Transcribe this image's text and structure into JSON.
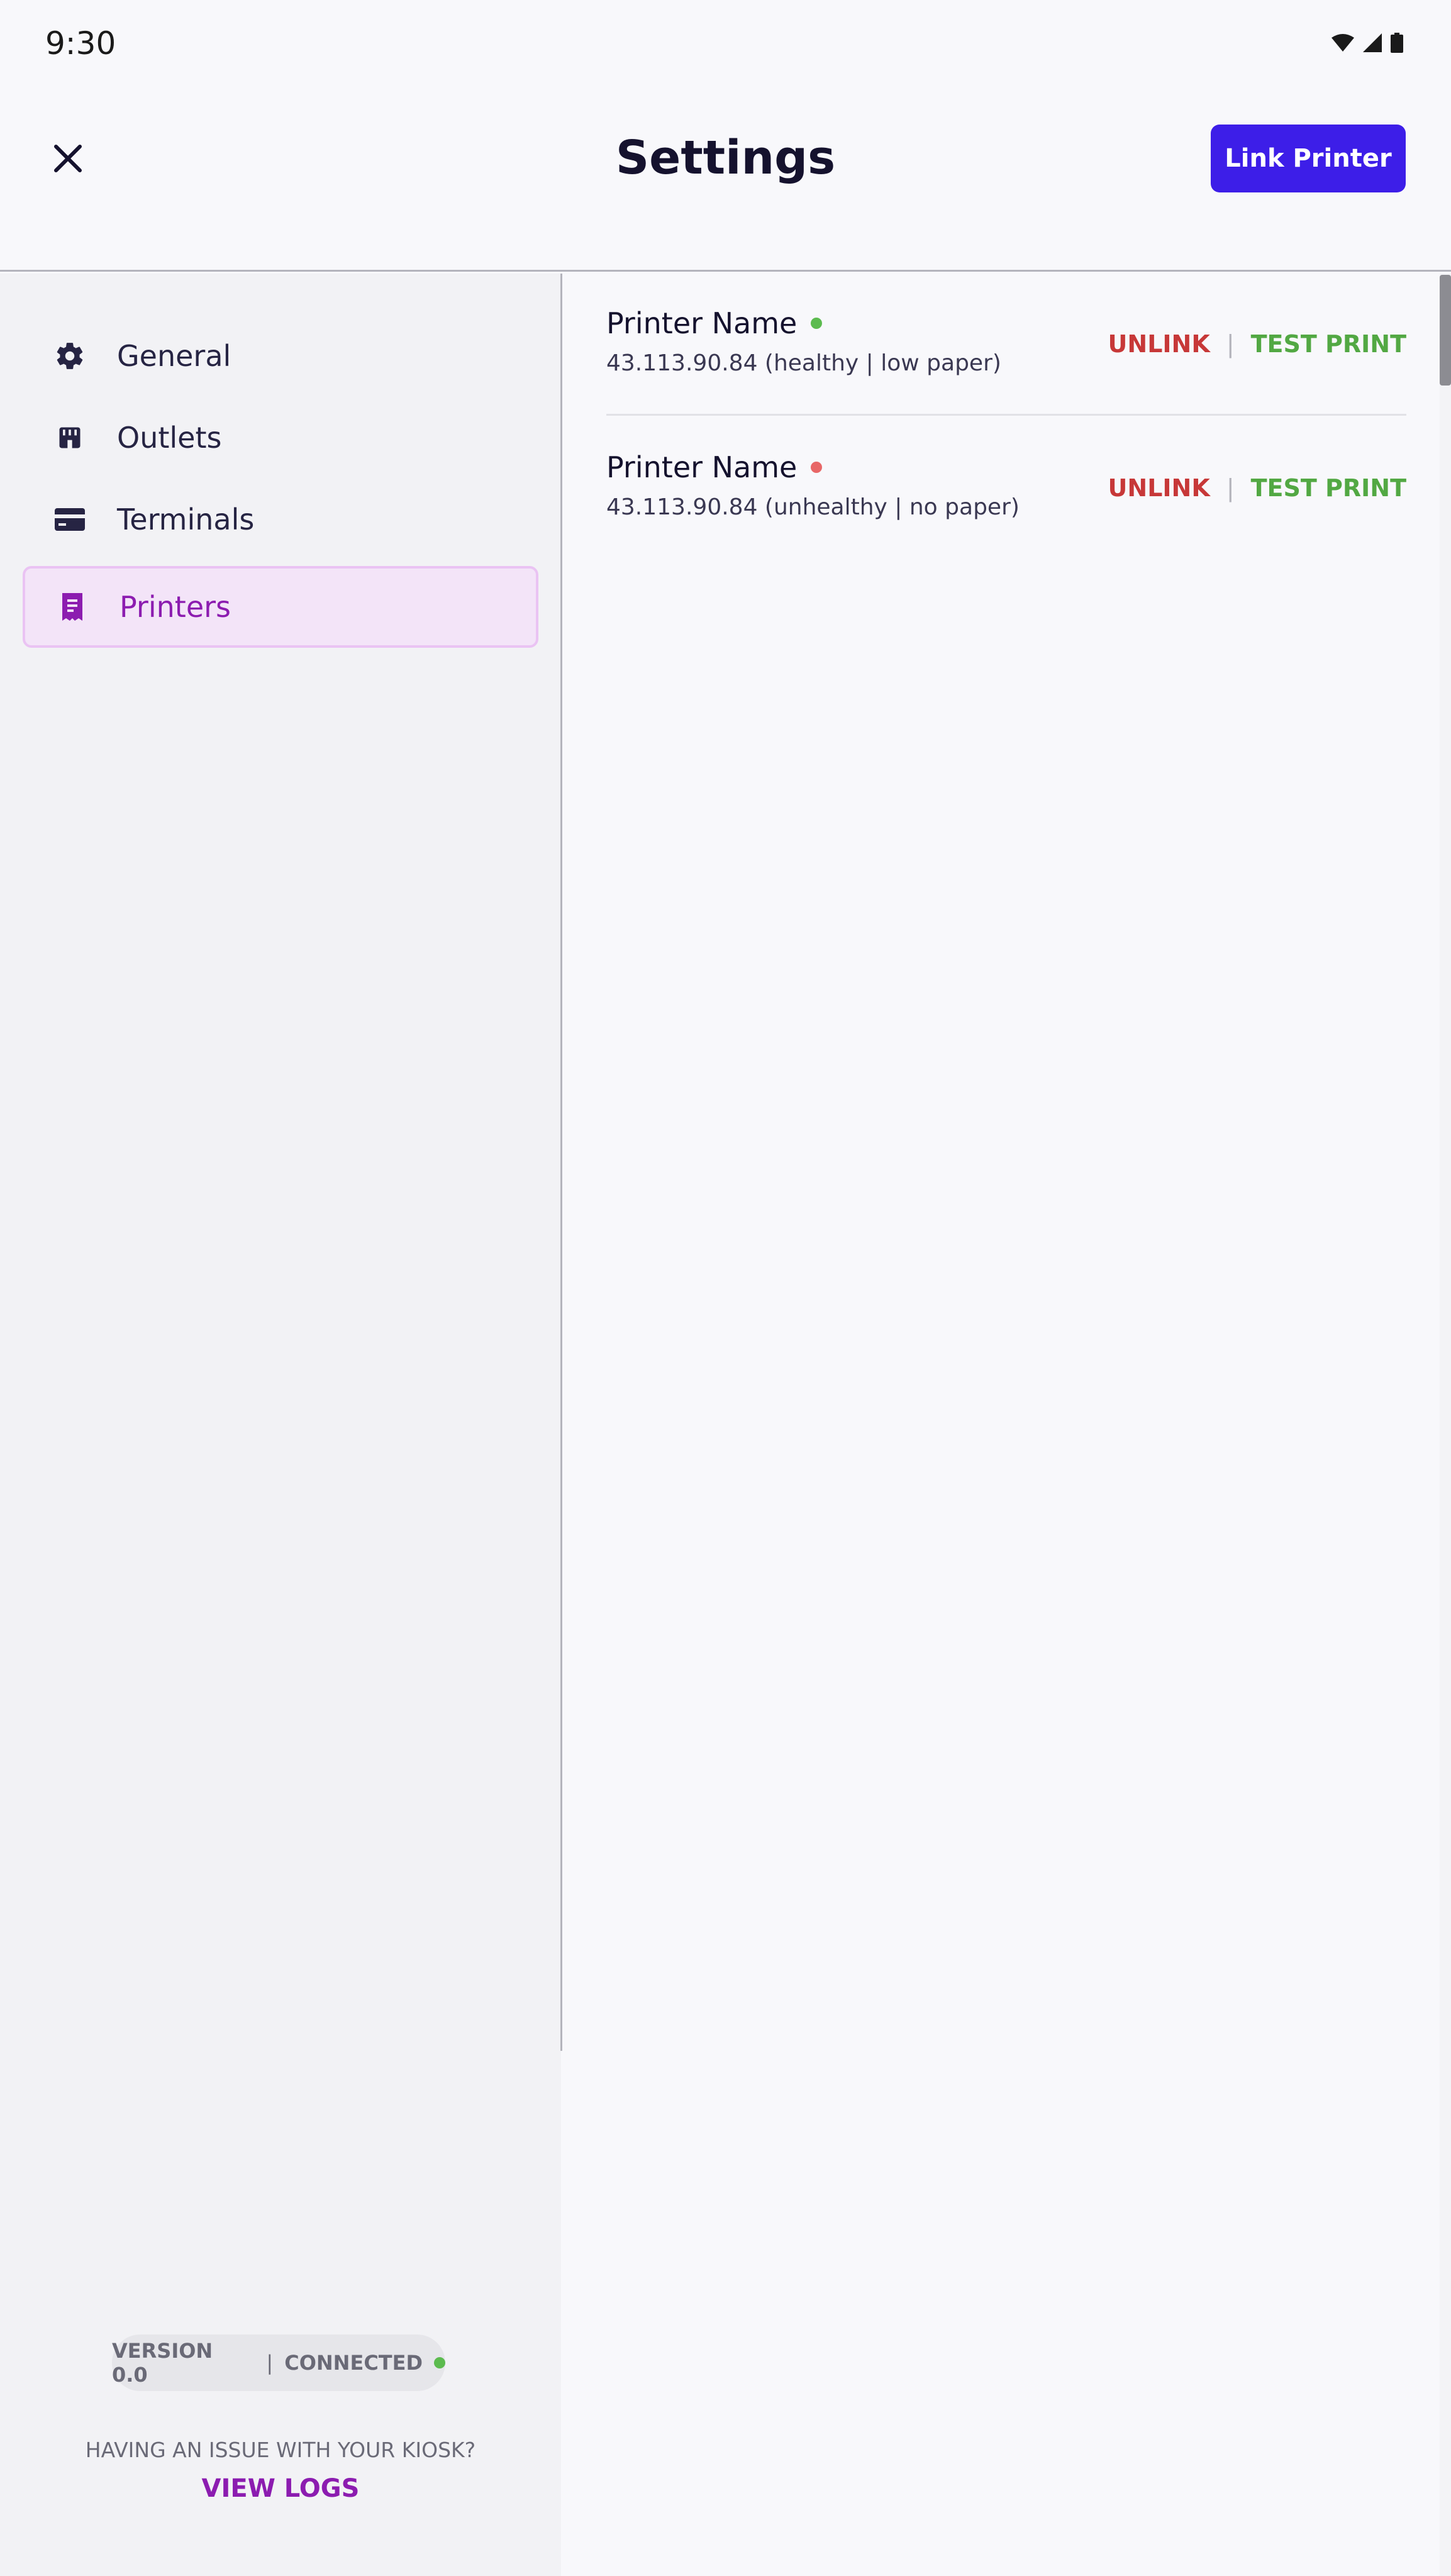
{
  "status_bar": {
    "time": "9:30"
  },
  "header": {
    "title": "Settings",
    "link_printer_label": "Link Printer"
  },
  "sidebar": {
    "items": [
      {
        "label": "General",
        "icon": "gear-icon"
      },
      {
        "label": "Outlets",
        "icon": "store-icon"
      },
      {
        "label": "Terminals",
        "icon": "card-icon"
      },
      {
        "label": "Printers",
        "icon": "receipt-icon",
        "active": true
      }
    ],
    "footer": {
      "version": "VERSION 0.0",
      "separator": "|",
      "connection": "CONNECTED",
      "issue_text": "HAVING AN ISSUE WITH YOUR KIOSK?",
      "view_logs": "VIEW LOGS"
    }
  },
  "printers": [
    {
      "name": "Printer Name",
      "meta": "43.113.90.84 (healthy | low paper)",
      "status": "healthy",
      "status_color": "#5cbb4f",
      "unlink": "UNLINK",
      "separator": "|",
      "test_print": "TEST PRINT"
    },
    {
      "name": "Printer Name",
      "meta": "43.113.90.84 (unhealthy | no paper)",
      "status": "unhealthy",
      "status_color": "#e86767",
      "unlink": "UNLINK",
      "separator": "|",
      "test_print": "TEST PRINT"
    }
  ],
  "colors": {
    "accent": "#3d1ee8",
    "active_nav": "#8c1cb0",
    "unlink": "#c73838",
    "test_print": "#52a843"
  }
}
